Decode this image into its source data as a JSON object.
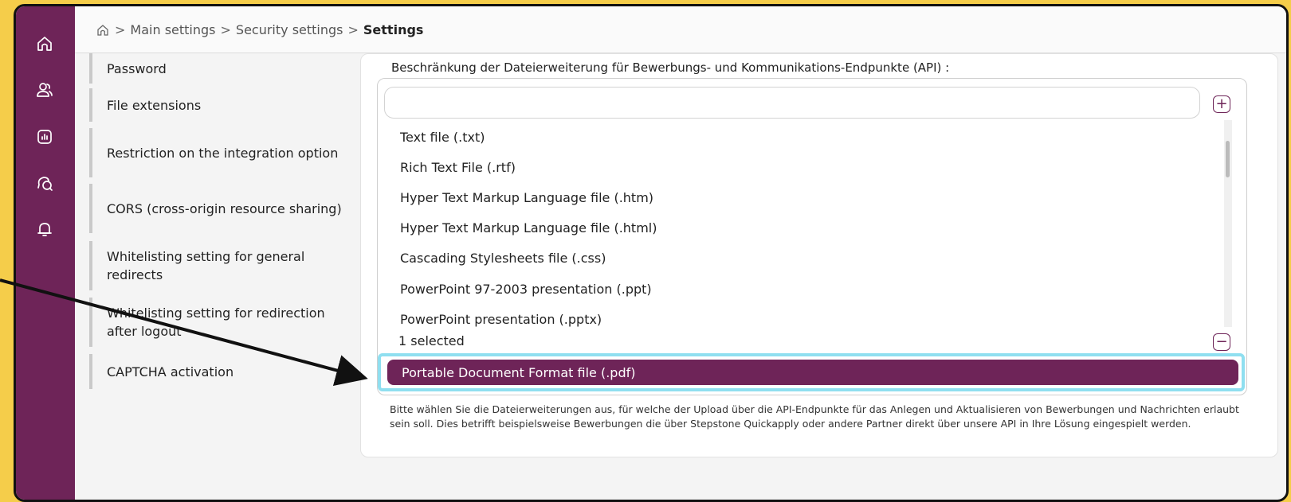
{
  "breadcrumb": {
    "items": [
      "Main settings",
      "Security settings"
    ],
    "current": "Settings",
    "separator": ">"
  },
  "rail": {
    "icons": [
      "home-icon",
      "users-icon",
      "analytics-icon",
      "chat-icon",
      "bell-icon"
    ]
  },
  "nav": {
    "items": [
      {
        "label": "Password"
      },
      {
        "label": "File extensions"
      },
      {
        "label": "Restriction on the integration option"
      },
      {
        "label": "CORS (cross-origin resource sharing)"
      },
      {
        "label": "Whitelisting setting for general redirects"
      },
      {
        "label": "Whitelisting setting for redirection after logout"
      },
      {
        "label": "CAPTCHA activation"
      }
    ]
  },
  "form": {
    "label": "Beschränkung der Dateierweiterung für Bewerbungs- und Kommunikations-Endpunkte (API) :",
    "search_value": "",
    "options": [
      "Text file (.txt)",
      "Rich Text File (.rtf)",
      "Hyper Text Markup Language file (.htm)",
      "Hyper Text Markup Language file (.html)",
      "Cascading Stylesheets file (.css)",
      "PowerPoint 97-2003 presentation (.ppt)",
      "PowerPoint presentation (.pptx)"
    ],
    "selected_count": "1 selected",
    "selected_items": [
      "Portable Document Format file (.pdf)"
    ],
    "help_text": "Bitte wählen Sie die Dateierweiterungen aus, für welche der Upload über die API-Endpunkte für das Anlegen und Aktualisieren von Bewerbungen und Nachrichten erlaubt sein soll. Dies betrifft beispielsweise Bewerbungen die über Stepstone Quickapply oder andere Partner direkt über unsere API in Ihre Lösung eingespielt werden."
  },
  "colors": {
    "brand": "#6e2458",
    "background": "#f5cd4a",
    "highlight": "#8fdff0"
  }
}
